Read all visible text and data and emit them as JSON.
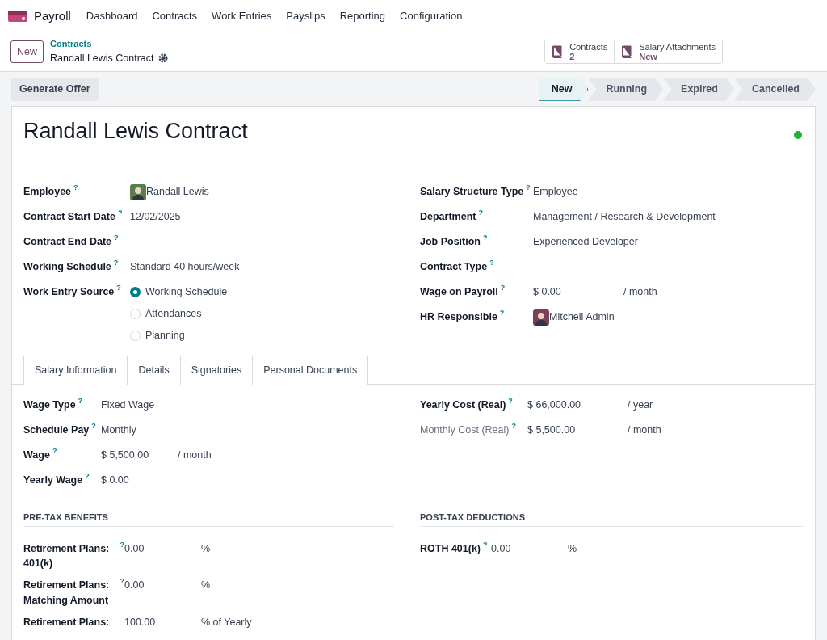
{
  "app": {
    "name": "Payroll",
    "menu": [
      "Dashboard",
      "Contracts",
      "Work Entries",
      "Payslips",
      "Reporting",
      "Configuration"
    ]
  },
  "control_panel": {
    "new_button": "New",
    "breadcrumb": "Contracts",
    "record": "Randall Lewis Contract",
    "smart_buttons": [
      {
        "label": "Contracts",
        "value": "2"
      },
      {
        "label": "Salary Attachments",
        "value": "New"
      }
    ]
  },
  "actions": [
    "Generate Offer"
  ],
  "stages": [
    {
      "label": "New",
      "selected": true
    },
    {
      "label": "Running",
      "selected": false
    },
    {
      "label": "Expired",
      "selected": false
    },
    {
      "label": "Cancelled",
      "selected": false
    }
  ],
  "form": {
    "title": "Randall Lewis Contract",
    "ready": true,
    "left_fields": [
      {
        "label": "Employee",
        "help": "?",
        "kind": "avatar",
        "value": "Randall Lewis"
      },
      {
        "label": "Contract Start Date",
        "help": "?",
        "kind": "text",
        "value": "12/02/2025"
      },
      {
        "label": "Contract End Date",
        "help": "?",
        "kind": "empty"
      },
      {
        "label": "Working Schedule",
        "help": "?",
        "kind": "text",
        "value": "Standard 40 hours/week"
      },
      {
        "label": "Work Entry Source",
        "help": "?",
        "kind": "radio",
        "options": [
          {
            "label": "Working Schedule",
            "selected": true
          },
          {
            "label": "Attendances",
            "selected": false
          },
          {
            "label": "Planning",
            "selected": false
          }
        ]
      }
    ],
    "right_fields": [
      {
        "label": "Salary Structure Type",
        "help": "?",
        "kind": "text",
        "value": "Employee"
      },
      {
        "label": "Department",
        "help": "?",
        "kind": "text",
        "value": "Management / Research & Development"
      },
      {
        "label": "Job Position",
        "help": "?",
        "kind": "text",
        "value": "Experienced Developer"
      },
      {
        "label": "Contract Type",
        "help": "?",
        "kind": "empty"
      },
      {
        "label": "Wage on Payroll",
        "help": "?",
        "kind": "monetary",
        "value": "$ 0.00",
        "unit": "/ month"
      },
      {
        "label": "HR Responsible",
        "help": "?",
        "kind": "avatar",
        "value": "Mitchell Admin"
      }
    ],
    "tabs": [
      {
        "label": "Salary Information",
        "selected": true
      },
      {
        "label": "Details",
        "selected": false
      },
      {
        "label": "Signatories",
        "selected": false
      },
      {
        "label": "Personal Documents",
        "selected": false
      }
    ],
    "salary_left": [
      {
        "label": "Wage Type",
        "help": "?",
        "value": "Fixed Wage"
      },
      {
        "label": "Schedule Pay",
        "help": "?",
        "value": "Monthly"
      },
      {
        "label": "Wage",
        "help": "?",
        "value": "$ 5,500.00",
        "unit": "/ month"
      },
      {
        "label": "Yearly Wage",
        "help": "?",
        "value": "$ 0.00"
      }
    ],
    "salary_right": [
      {
        "label": "Yearly Cost (Real)",
        "help": "?",
        "value": "$ 66,000.00",
        "unit": "/ year",
        "readonly": false
      },
      {
        "label": "Monthly Cost (Real)",
        "help": "?",
        "value": "$ 5,500.00",
        "unit": "/ month",
        "readonly": true
      }
    ],
    "sections": [
      {
        "title": "PRE-TAX BENEFITS",
        "fields": [
          {
            "label": "Retirement Plans: 401(k)",
            "help": "?",
            "value": "0.00",
            "unit": "%"
          },
          {
            "label": "Retirement Plans: Matching Amount",
            "help": "?",
            "value": "0.00",
            "unit": "%"
          },
          {
            "label": "Retirement Plans:",
            "value": "100.00",
            "unit": "% of Yearly"
          }
        ]
      },
      {
        "title": "POST-TAX DEDUCTIONS",
        "fields": [
          {
            "label": "ROTH 401(k)",
            "help": "?",
            "value": "0.00",
            "unit": "%"
          }
        ]
      }
    ]
  }
}
